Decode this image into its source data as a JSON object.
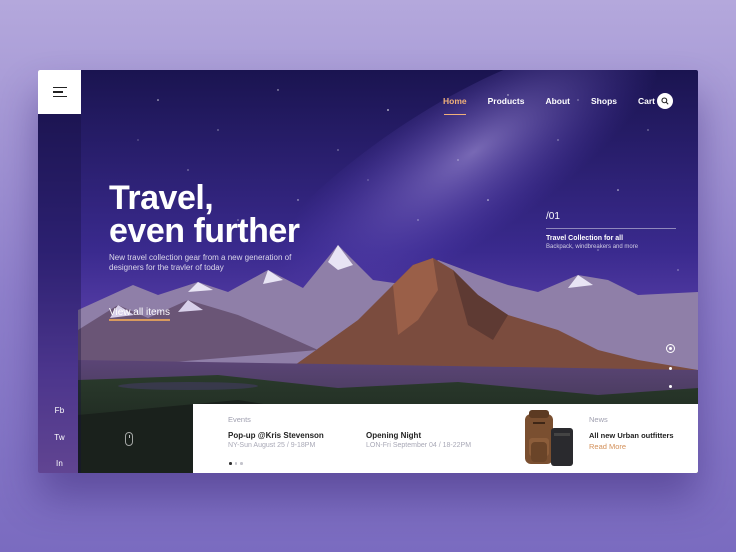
{
  "nav": {
    "items": [
      {
        "label": "Home",
        "active": true
      },
      {
        "label": "Products",
        "active": false
      },
      {
        "label": "About",
        "active": false
      },
      {
        "label": "Shops",
        "active": false
      },
      {
        "label": "Cart",
        "active": false
      }
    ],
    "search_icon": "search-icon",
    "menu_icon": "hamburger-menu-icon"
  },
  "hero": {
    "title_line1": "Travel,",
    "title_line2": "even further",
    "subtitle": "New travel collection gear from a new generation of designers for the travler of today",
    "cta": "View all items"
  },
  "slide": {
    "number": "/01",
    "title": "Travel Collection for all",
    "subtitle": "Backpack, windbreakers and more"
  },
  "social": [
    "Fb",
    "Tw",
    "In"
  ],
  "events": {
    "label": "Events",
    "items": [
      {
        "title": "Pop-up @Kris Stevenson",
        "date": "NY-Sun August 25 / 9-18PM"
      },
      {
        "title": "Opening Night",
        "date": "LON-Fri September 04 / 18-22PM"
      }
    ]
  },
  "news": {
    "label": "News",
    "title": "All new Urban outfitters",
    "more": "Read More"
  },
  "colors": {
    "accent": "#f0b07a",
    "link": "#d3905a",
    "sky_top": "#1c1552",
    "sky_mid": "#5537a8"
  }
}
